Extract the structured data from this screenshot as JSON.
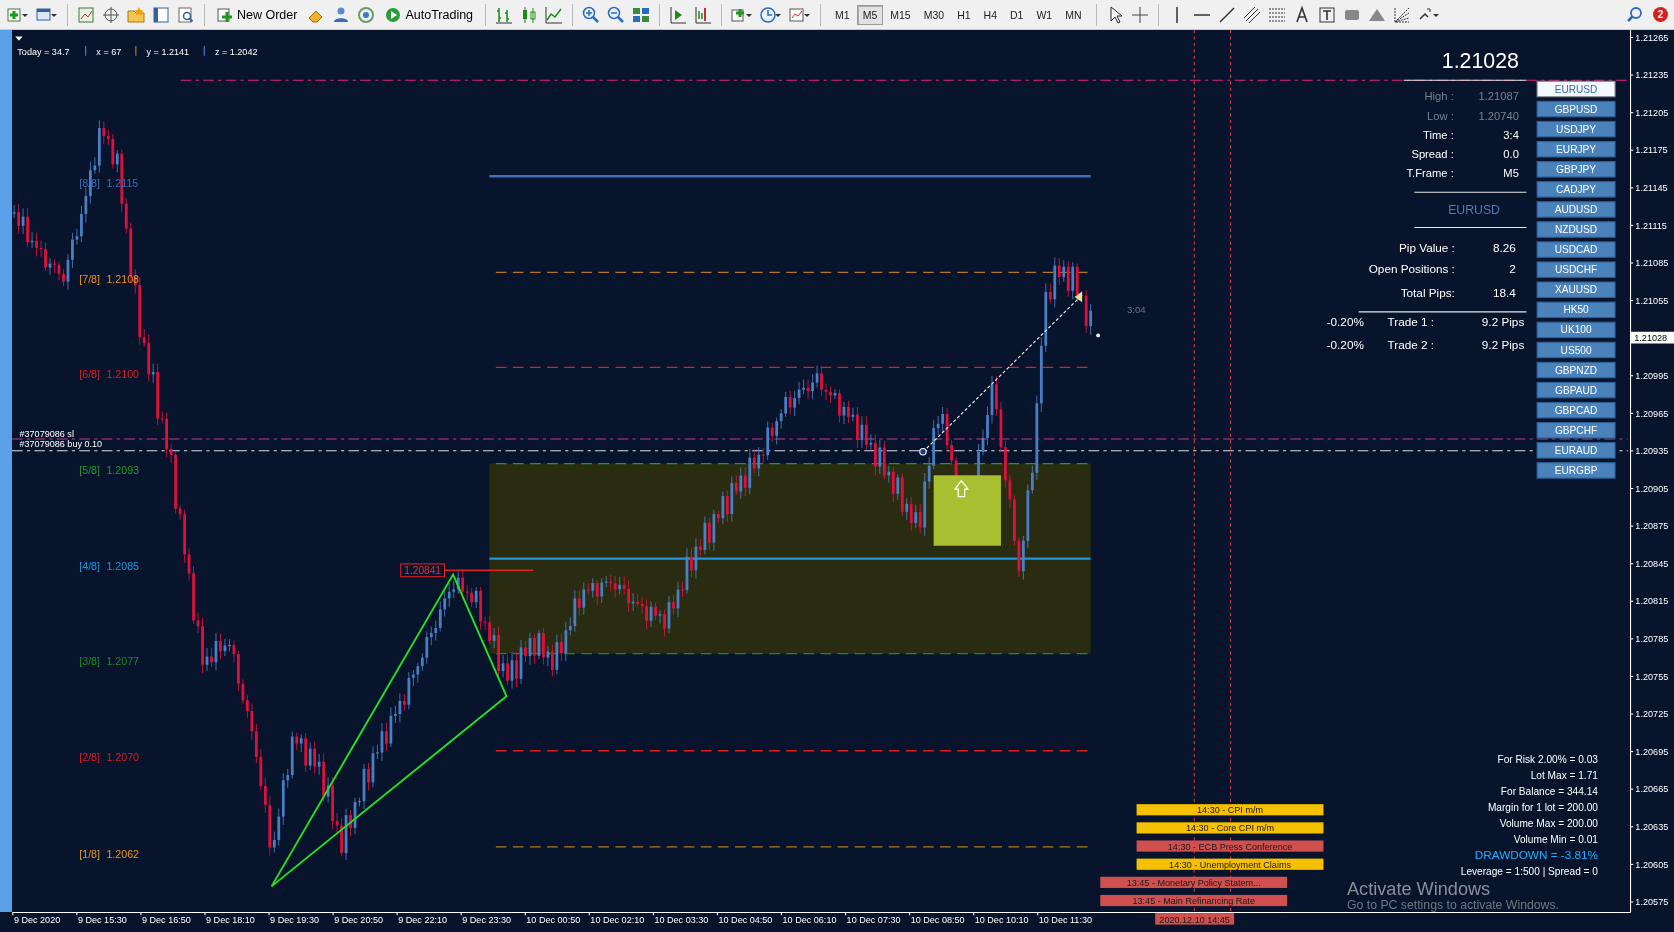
{
  "toolbar": {
    "buttons": [
      {
        "kind": "order",
        "label": "New Order"
      },
      {
        "kind": "auto",
        "label": "AutoTrading"
      }
    ],
    "timeframes": [
      {
        "label": "M1",
        "selected": false
      },
      {
        "label": "M5",
        "selected": true
      },
      {
        "label": "M15",
        "selected": false
      },
      {
        "label": "M30",
        "selected": false
      },
      {
        "label": "H1",
        "selected": false
      },
      {
        "label": "H4",
        "selected": false
      },
      {
        "label": "D1",
        "selected": false
      },
      {
        "label": "W1",
        "selected": false
      },
      {
        "label": "MN",
        "selected": false
      }
    ],
    "notification_count": "2"
  },
  "chart": {
    "status_line": [
      "Today = 34.7",
      "x = 67",
      "y = 1.2141",
      "z = 1.2042"
    ],
    "murrey_levels": [
      {
        "label": "[8/8]",
        "price": "1.2115",
        "color": "#3e6fb8"
      },
      {
        "label": "[7/8]",
        "price": "1.2108",
        "color": "#e8961e"
      },
      {
        "label": "[6/8]",
        "price": "1.2100",
        "color": "#e01e1e"
      },
      {
        "label": "[5/8]",
        "price": "1.2093",
        "color": "#1e9a28"
      },
      {
        "label": "[4/8]",
        "price": "1.2085",
        "color": "#1e96dc"
      },
      {
        "label": "[3/8]",
        "price": "1.2077",
        "color": "#1e8a28"
      },
      {
        "label": "[2/8]",
        "price": "1.2070",
        "color": "#dc1e1e"
      },
      {
        "label": "[1/8]",
        "price": "1.2062",
        "color": "#e8961e"
      }
    ],
    "orders": [
      "#37079086 sl",
      "#37079086 buy 0.10"
    ],
    "price_tag": "1.20841",
    "countdown": "3:04",
    "info_panel": {
      "price": "1.21028",
      "rows": [
        {
          "label": "High :",
          "value": "1.21087",
          "dim": true
        },
        {
          "label": "Low :",
          "value": "1.20740",
          "dim": true
        },
        {
          "label": "Time :",
          "value": "3:4",
          "dim": false
        },
        {
          "label": "Spread :",
          "value": "0.0",
          "dim": false
        },
        {
          "label": "T.Frame :",
          "value": "M5",
          "dim": false
        }
      ],
      "symbol": "EURUSD",
      "stats": [
        {
          "label": "Pip Value :",
          "value": "8.26"
        },
        {
          "label": "Open Positions :",
          "value": "2"
        },
        {
          "label": "Total Pips:",
          "value": "18.4"
        }
      ],
      "trades": [
        {
          "percent": "-0.20%",
          "label": "Trade 1 :",
          "value": "9.2 Pips"
        },
        {
          "percent": "-0.20%",
          "label": "Trade 2 :",
          "value": "9.2 Pips"
        }
      ]
    },
    "symbols": [
      {
        "label": "EURUSD",
        "selected": true
      },
      {
        "label": "GBPUSD",
        "selected": false
      },
      {
        "label": "USDJPY",
        "selected": false
      },
      {
        "label": "EURJPY",
        "selected": false
      },
      {
        "label": "GBPJPY",
        "selected": false
      },
      {
        "label": "CADJPY",
        "selected": false
      },
      {
        "label": "AUDUSD",
        "selected": false
      },
      {
        "label": "NZDUSD",
        "selected": false
      },
      {
        "label": "USDCAD",
        "selected": false
      },
      {
        "label": "USDCHF",
        "selected": false
      },
      {
        "label": "XAUUSD",
        "selected": false
      },
      {
        "label": "HK50",
        "selected": false
      },
      {
        "label": "UK100",
        "selected": false
      },
      {
        "label": "US500",
        "selected": false
      },
      {
        "label": "GBPNZD",
        "selected": false
      },
      {
        "label": "GBPAUD",
        "selected": false
      },
      {
        "label": "GBPCAD",
        "selected": false
      },
      {
        "label": "GBPCHF",
        "selected": false
      },
      {
        "label": "EURAUD",
        "selected": false
      },
      {
        "label": "EURGBP",
        "selected": false
      }
    ],
    "risk_panel": [
      {
        "text": "For Risk 2.00% = 0.03",
        "kind": "normal"
      },
      {
        "text": "Lot Max = 1.71",
        "kind": "normal"
      },
      {
        "text": "For Balance = 344.14",
        "kind": "normal"
      },
      {
        "text": "Margin for 1 lot = 200.00",
        "kind": "normal"
      },
      {
        "text": "Volume Max = 200.00",
        "kind": "normal"
      },
      {
        "text": "Volume Min = 0.01",
        "kind": "normal"
      },
      {
        "text": "DRAWDOWN = -3.81%",
        "kind": "alert"
      },
      {
        "text": "Leverage = 1:500 | Spread = 0",
        "kind": "normal"
      }
    ],
    "events": [
      {
        "text": "14:30 - CPI m/m",
        "color": "#f5c000"
      },
      {
        "text": "14:30 - Core CPI m/m",
        "color": "#f5c000"
      },
      {
        "text": "14:30 - ECB Press Conference",
        "color": "#d05050"
      },
      {
        "text": "14:30 - Unemployment Claims",
        "color": "#f5c000"
      },
      {
        "text": "13:45 - Monetary Policy Statem...",
        "color": "#d05050"
      },
      {
        "text": "13:45 - Main Refinancing Rate",
        "color": "#d05050"
      }
    ],
    "cursor_time": "2020.12.10 14:45",
    "watermark": {
      "title": "Activate Windows",
      "subtitle": "Go to PC settings to activate Windows."
    }
  },
  "price_axis": {
    "labels": [
      {
        "kind": "tick",
        "text": "1.21265"
      },
      {
        "kind": "tick",
        "text": "1.21235"
      },
      {
        "kind": "tick",
        "text": "1.21205"
      },
      {
        "kind": "tick",
        "text": "1.21175"
      },
      {
        "kind": "tick",
        "text": "1.21145"
      },
      {
        "kind": "tick",
        "text": "1.21115"
      },
      {
        "kind": "tick",
        "text": "1.21085"
      },
      {
        "kind": "tick",
        "text": "1.21055"
      },
      {
        "kind": "current",
        "text": "1.21028"
      },
      {
        "kind": "tick",
        "text": "1.20995"
      },
      {
        "kind": "tick",
        "text": "1.20965"
      },
      {
        "kind": "tick",
        "text": "1.20935"
      },
      {
        "kind": "tick",
        "text": "1.20905"
      },
      {
        "kind": "tick",
        "text": "1.20875"
      },
      {
        "kind": "tick",
        "text": "1.20845"
      },
      {
        "kind": "tick",
        "text": "1.20815"
      },
      {
        "kind": "tick",
        "text": "1.20785"
      },
      {
        "kind": "tick",
        "text": "1.20755"
      },
      {
        "kind": "tick",
        "text": "1.20725"
      },
      {
        "kind": "tick",
        "text": "1.20695"
      },
      {
        "kind": "tick",
        "text": "1.20665"
      },
      {
        "kind": "tick",
        "text": "1.20635"
      },
      {
        "kind": "tick",
        "text": "1.20605"
      },
      {
        "kind": "tick",
        "text": "1.20575"
      }
    ]
  },
  "time_axis": {
    "labels": [
      "9 Dec 2020",
      "9 Dec 15:30",
      "9 Dec 16:50",
      "9 Dec 18:10",
      "9 Dec 19:30",
      "9 Dec 20:50",
      "9 Dec 22:10",
      "9 Dec 23:30",
      "10 Dec 00:50",
      "10 Dec 02:10",
      "10 Dec 03:30",
      "10 Dec 04:50",
      "10 Dec 06:10",
      "10 Dec 07:30",
      "10 Dec 08:50",
      "10 Dec 10:10",
      "10 Dec 11:30"
    ]
  }
}
